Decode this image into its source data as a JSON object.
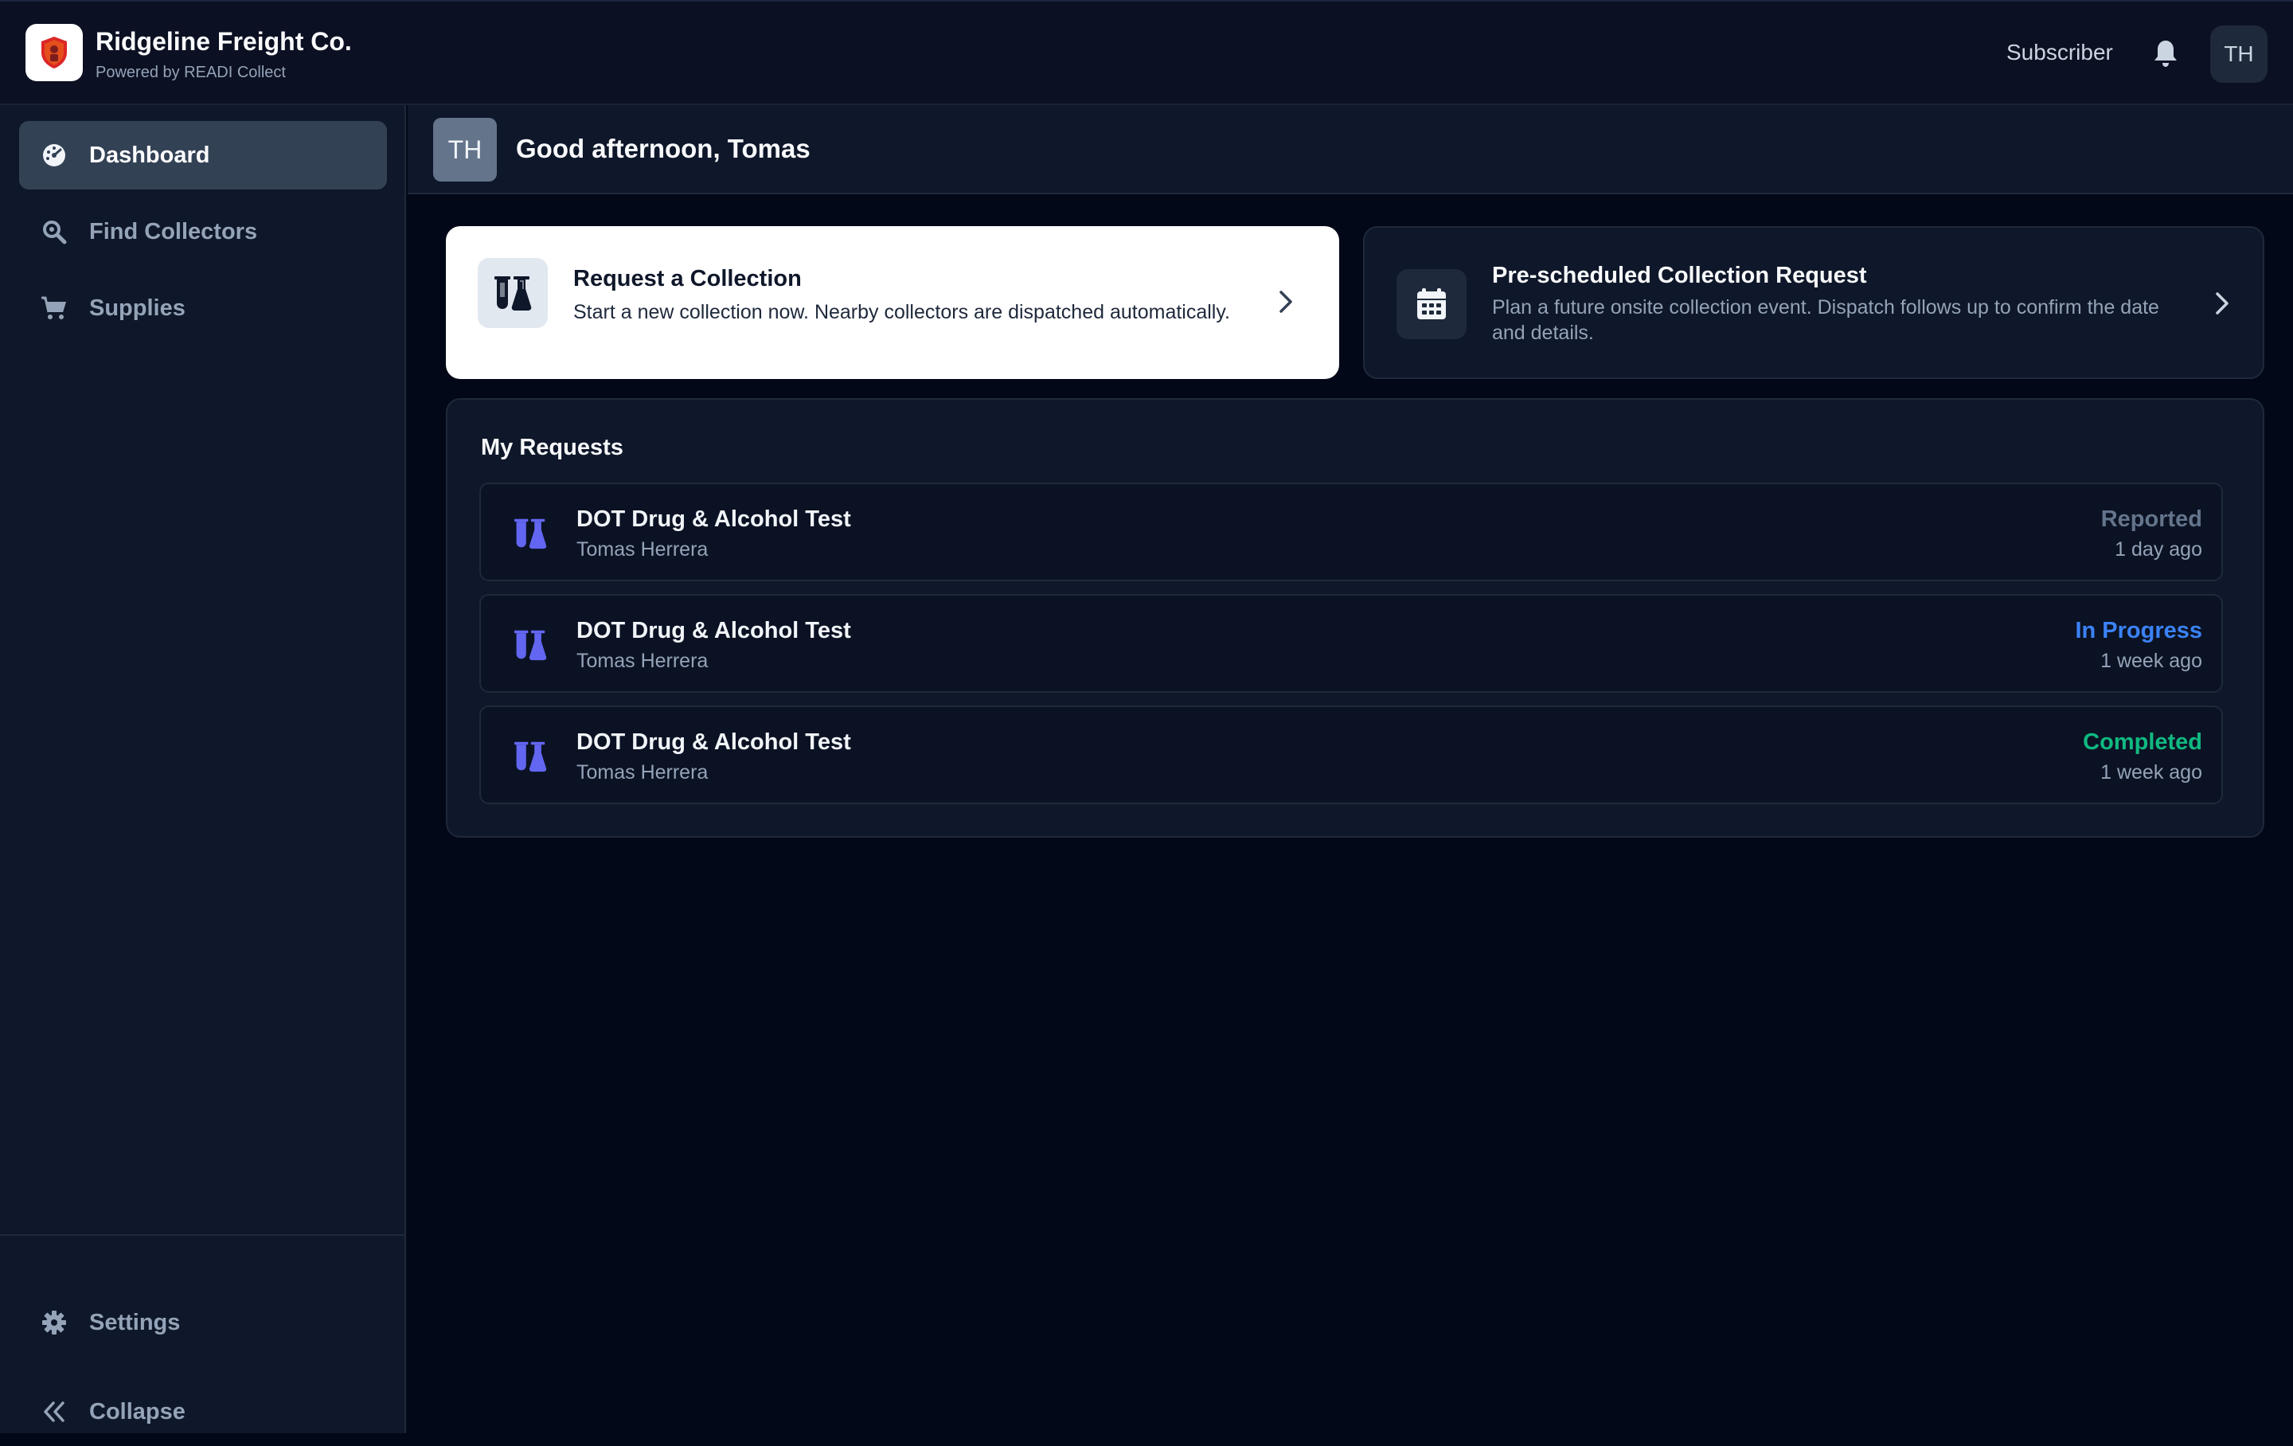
{
  "header": {
    "brand_name": "Ridgeline Freight Co.",
    "brand_sub": "Powered by READI Collect",
    "role": "Subscriber",
    "avatar_initials": "TH"
  },
  "sidebar": {
    "items": [
      {
        "label": "Dashboard",
        "icon": "dashboard-gauge-icon",
        "active": true
      },
      {
        "label": "Find Collectors",
        "icon": "search-icon",
        "active": false
      },
      {
        "label": "Supplies",
        "icon": "cart-icon",
        "active": false
      }
    ],
    "bottom": [
      {
        "label": "Settings",
        "icon": "gear-icon"
      },
      {
        "label": "Collapse",
        "icon": "double-chevron-left-icon"
      }
    ]
  },
  "greeting": {
    "avatar_initials": "TH",
    "text": "Good afternoon, Tomas"
  },
  "cards": {
    "request": {
      "title": "Request a Collection",
      "desc": "Start a new collection now. Nearby collectors are dispatched automatically.",
      "icon": "flasks-icon"
    },
    "prescheduled": {
      "title": "Pre-scheduled Collection Request",
      "desc": "Plan a future onsite collection event. Dispatch follows up to confirm the date and details.",
      "icon": "calendar-icon"
    }
  },
  "requests": {
    "title": "My Requests",
    "rows": [
      {
        "title": "DOT Drug & Alcohol Test",
        "name": "Tomas Herrera",
        "status": "Reported",
        "status_color": "#64748b",
        "time": "1 day ago"
      },
      {
        "title": "DOT Drug & Alcohol Test",
        "name": "Tomas Herrera",
        "status": "In Progress",
        "status_color": "#3b82f6",
        "time": "1 week ago"
      },
      {
        "title": "DOT Drug & Alcohol Test",
        "name": "Tomas Herrera",
        "status": "Completed",
        "status_color": "#10b981",
        "time": "1 week ago"
      }
    ]
  },
  "colors": {
    "accent_icon": "#6366f1"
  }
}
